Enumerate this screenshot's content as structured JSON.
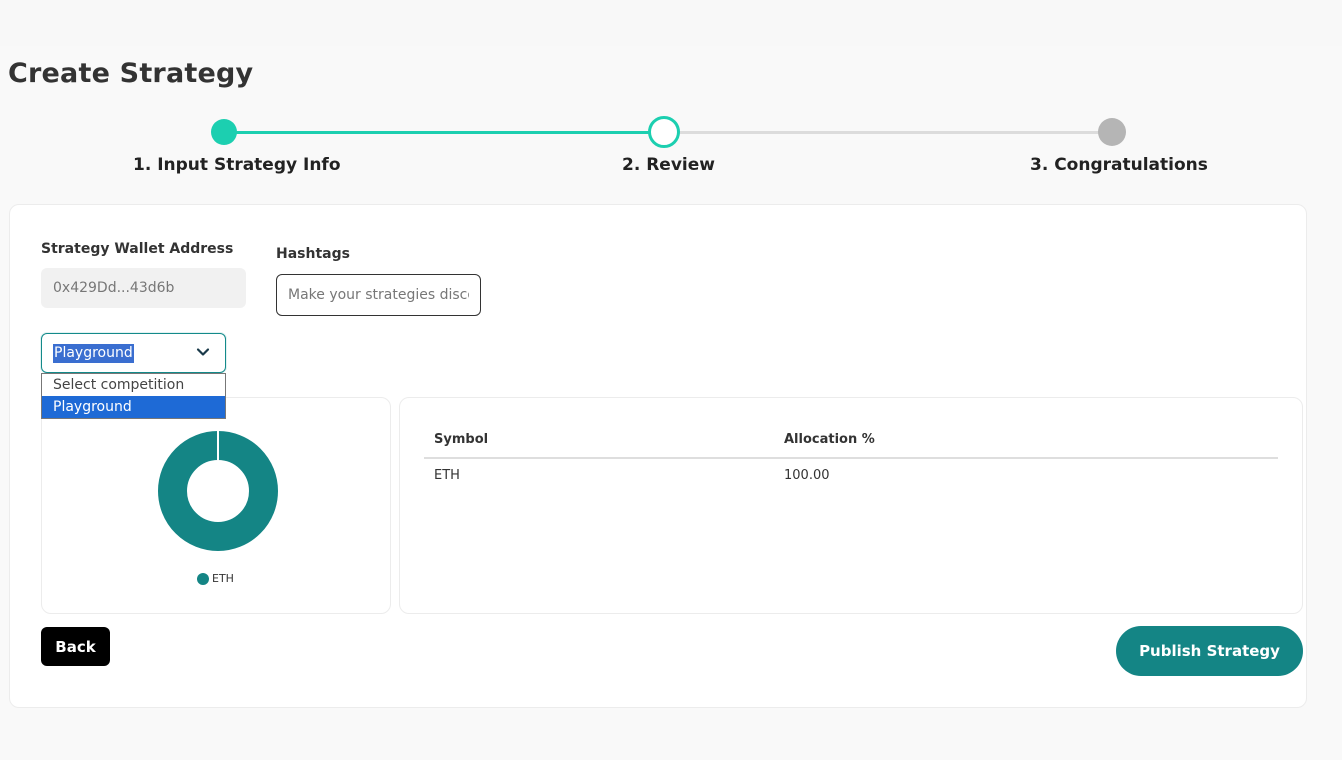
{
  "page": {
    "title": "Create Strategy"
  },
  "stepper": {
    "steps": [
      {
        "label": "1. Input Strategy Info",
        "state": "done"
      },
      {
        "label": "2. Review",
        "state": "current"
      },
      {
        "label": "3. Congratulations",
        "state": "upcoming"
      }
    ],
    "colors": {
      "active": "#1ccfb0",
      "inactive": "#b5b5b5"
    }
  },
  "form": {
    "wallet_label": "Strategy Wallet Address",
    "wallet_value": "0x429Dd...43d6b",
    "hashtags_label": "Hashtags",
    "hashtags_placeholder": "Make your strategies discoverable",
    "competition_selected": "Playground",
    "competition_options": [
      "Select competition",
      "Playground"
    ]
  },
  "allocation": {
    "chart_data": {
      "type": "pie",
      "style": "donut",
      "categories": [
        "ETH"
      ],
      "values": [
        100
      ],
      "legend": [
        "ETH"
      ],
      "colors": [
        "#148585"
      ]
    },
    "table": {
      "headers": [
        "Symbol",
        "Allocation %"
      ],
      "rows": [
        [
          "ETH",
          "100.00"
        ]
      ]
    }
  },
  "actions": {
    "back_label": "Back",
    "publish_label": "Publish Strategy"
  },
  "colors": {
    "brand": "#148585",
    "accent": "#1ccfb0"
  }
}
